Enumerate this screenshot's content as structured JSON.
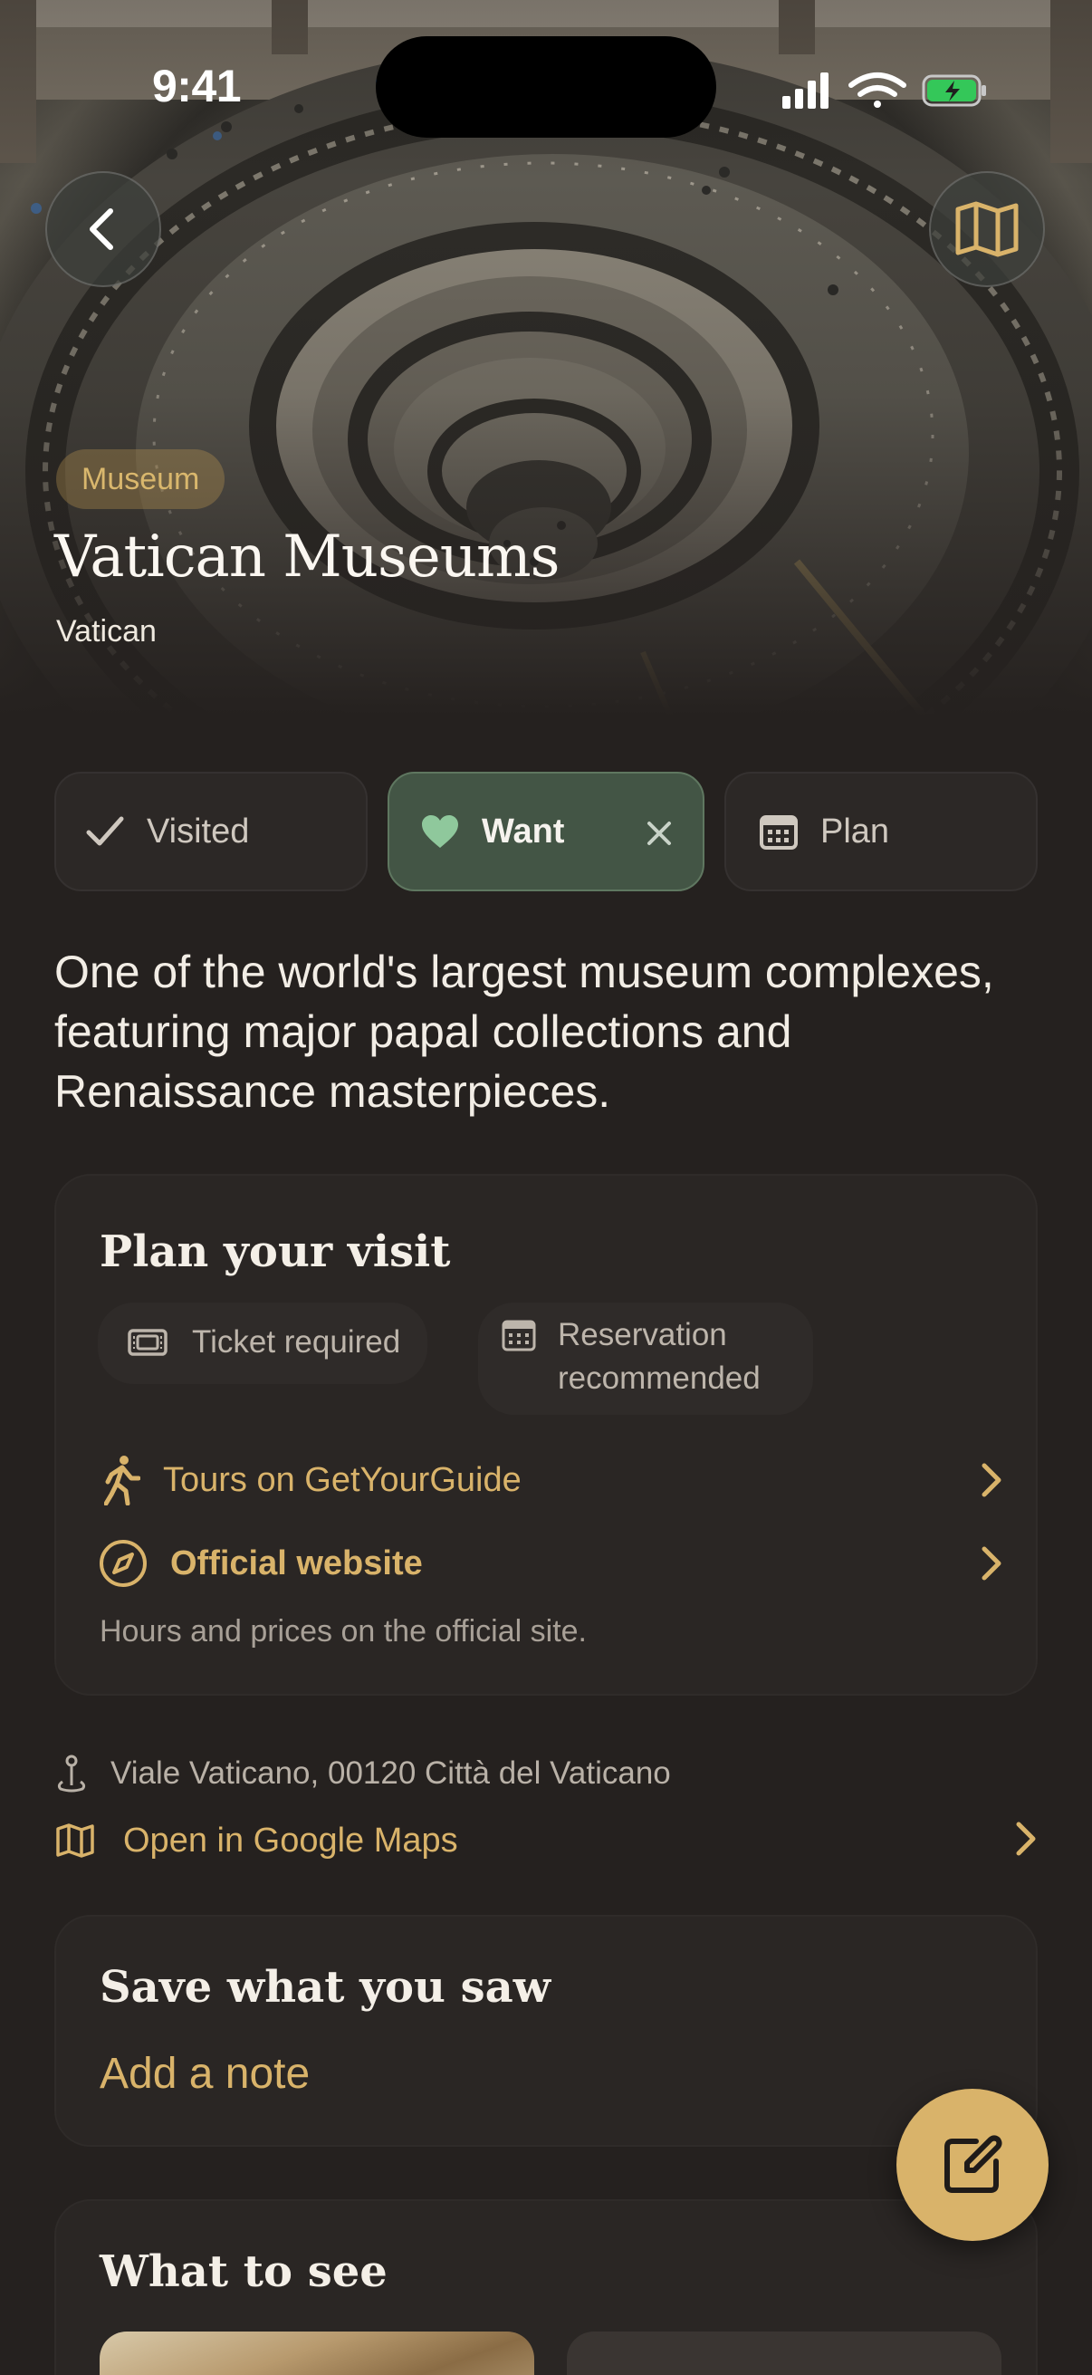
{
  "status_bar": {
    "time": "9:41"
  },
  "hero": {
    "category": "Museum",
    "title": "Vatican Museums",
    "subtitle": "Vatican"
  },
  "actions": {
    "visited_label": "Visited",
    "want_label": "Want",
    "plan_label": "Plan"
  },
  "description": "One of the world's largest museum complexes, featuring major papal collections and Renaissance masterpieces.",
  "plan_card": {
    "title": "Plan your visit",
    "ticket_chip": "Ticket required",
    "reservation_chip": "Reservation recommended",
    "tours_link": "Tours on GetYourGuide",
    "website_link": "Official website",
    "hours_note": "Hours and prices on the official site."
  },
  "location": {
    "address": "Viale Vaticano, 00120 Città del Vaticano",
    "maps_link": "Open in Google Maps"
  },
  "note_card": {
    "title": "Save what you saw",
    "add_note": "Add a note"
  },
  "see_card": {
    "title": "What to see"
  },
  "colors": {
    "background": "#25211f",
    "accent": "#d9b36a",
    "want_active": "#435545"
  },
  "icons": {
    "back": "chevron-left-icon",
    "map": "map-icon",
    "visited": "checkmark-icon",
    "want": "heart-icon",
    "want_clear": "close-icon",
    "plan": "calendar-icon",
    "ticket": "ticket-icon",
    "reservation": "calendar-icon",
    "tours": "walking-person-icon",
    "website": "compass-icon",
    "address": "pin-icon",
    "maps": "map-icon",
    "fab": "edit-icon"
  }
}
